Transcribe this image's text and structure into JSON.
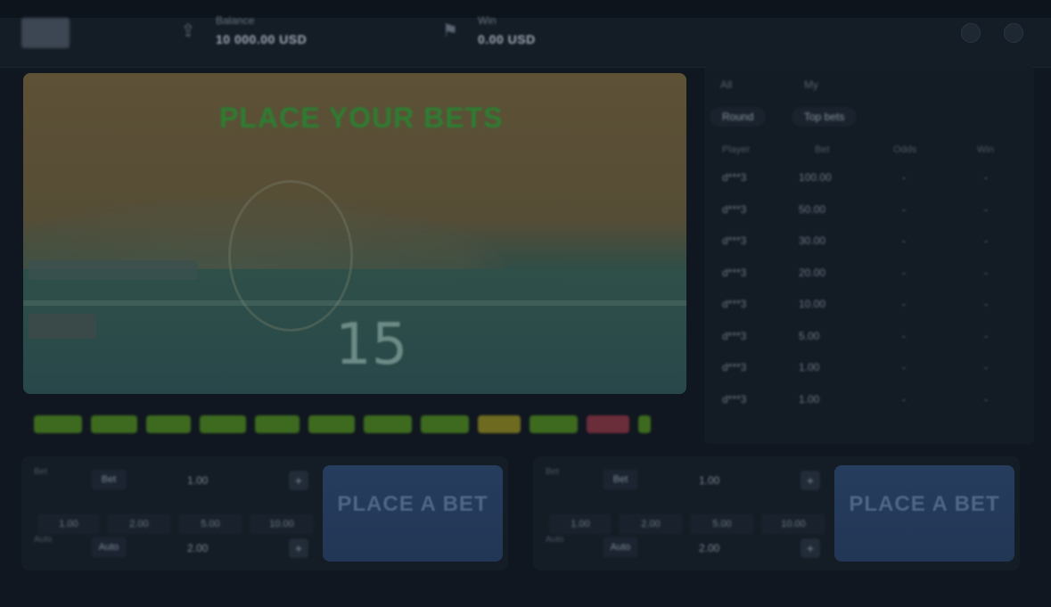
{
  "header": {
    "logo_text": "",
    "balance_label": "Balance",
    "balance_value": "10 000.00 USD",
    "win_label": "Win",
    "win_value": "0.00 USD"
  },
  "game": {
    "status_text": "PLACE YOUR BETS",
    "timer_value": "15"
  },
  "history_chips": [
    {
      "color": "#3d6a1f"
    },
    {
      "color": "#3d6a1f"
    },
    {
      "color": "#3d6a1f"
    },
    {
      "color": "#3d6a1f"
    },
    {
      "color": "#3d6a1f"
    },
    {
      "color": "#3d6a1f"
    },
    {
      "color": "#3d6a1f"
    },
    {
      "color": "#3d6a1f"
    },
    {
      "color": "#6e6a1f"
    },
    {
      "color": "#3d6a1f"
    },
    {
      "color": "#6a2d3a"
    },
    {
      "color": "#3d6a1f"
    }
  ],
  "bets_panel": {
    "tabs": [
      "All",
      "My"
    ],
    "filters": [
      "Round",
      "Top bets"
    ],
    "columns": [
      "Player",
      "Bet",
      "Odds",
      "Win"
    ],
    "rows": [
      {
        "player": "d***3",
        "bet": "100.00",
        "odds": "-",
        "win": "-"
      },
      {
        "player": "d***3",
        "bet": "50.00",
        "odds": "-",
        "win": "-"
      },
      {
        "player": "d***3",
        "bet": "30.00",
        "odds": "-",
        "win": "-"
      },
      {
        "player": "d***3",
        "bet": "20.00",
        "odds": "-",
        "win": "-"
      },
      {
        "player": "d***3",
        "bet": "10.00",
        "odds": "-",
        "win": "-"
      },
      {
        "player": "d***3",
        "bet": "5.00",
        "odds": "-",
        "win": "-"
      },
      {
        "player": "d***3",
        "bet": "1.00",
        "odds": "-",
        "win": "-"
      },
      {
        "player": "d***3",
        "bet": "1.00",
        "odds": "-",
        "win": "-"
      }
    ]
  },
  "bet_boxes": [
    {
      "bet_label": "Bet",
      "bet_amount": "1.00",
      "quick_amounts": [
        "1.00",
        "2.00",
        "5.00",
        "10.00"
      ],
      "cashout_label": "Auto",
      "cashout_amount": "2.00",
      "button_main": "PLACE A BET",
      "button_sub": ""
    },
    {
      "bet_label": "Bet",
      "bet_amount": "1.00",
      "quick_amounts": [
        "1.00",
        "2.00",
        "5.00",
        "10.00"
      ],
      "cashout_label": "Auto",
      "cashout_amount": "2.00",
      "button_main": "PLACE A BET",
      "button_sub": ""
    }
  ]
}
